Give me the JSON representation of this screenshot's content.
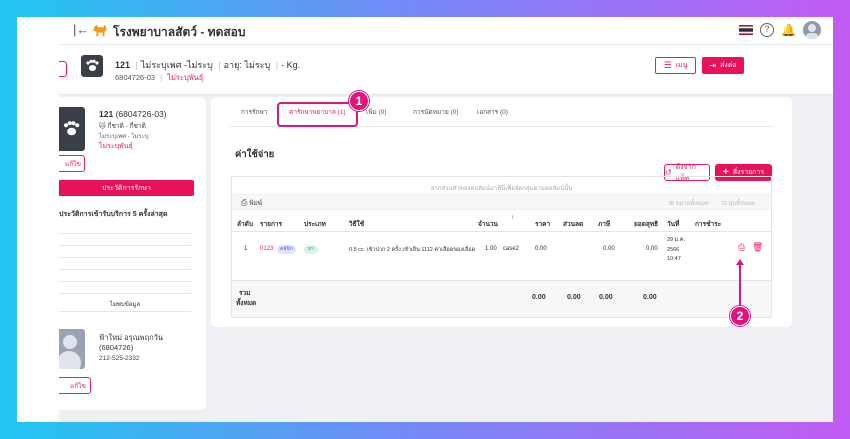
{
  "app": {
    "title": "โรงพยาบาลสัตว์ - ทดสอบ"
  },
  "patient_header": {
    "id": "121",
    "gender": "ไม่ระบุเพศ -ไม่ระบุ",
    "age": "อายุ: ไม่ระบุ",
    "weight": "- Kg.",
    "hn": "6804726-03",
    "sterile": "ไม่ระบุพันธุ์",
    "menu_label": "เมนู",
    "discharge_label": "ส่งต่อ"
  },
  "left_card": {
    "pet_id": "121",
    "pet_hn": "(6804726-03)",
    "species": "🐱 กี่ชาติ - กี่ชาติ",
    "gender_line": "ไม่ระบุเพศ - ไม่ระบุ",
    "breed": "ไม่ระบุพันธุ์",
    "edit_label": "แก้ไข",
    "history_button": "ประวัติการรักษา",
    "recent_title": "ประวัติการเข้ารับบริการ 5 ครั้งล่าสุด",
    "no_data": "ไม่พบข้อมูล",
    "owner_name": "ฟ้าใหม่ อรุณพฤกวัน",
    "owner_id": "(6804726)",
    "owner_phone": "212-525-2332",
    "owner_edit_label": "แก้ไข"
  },
  "tabs": [
    {
      "label": "การรักษา"
    },
    {
      "label": "ค่ารักษาพยาบาล (1)"
    },
    {
      "label": "เพิ่ม (0)"
    },
    {
      "label": "การนัดหมาย (0)"
    },
    {
      "label": "เอกสาร (0)"
    }
  ],
  "annotations": {
    "step1": "1",
    "step2": "2"
  },
  "costs": {
    "title": "ค่าใช้จ่าย",
    "history_button": "ดึงจากแพ็ค",
    "add_button": "สั่งรายการ",
    "hint": "ลากส่วนหัวของคอลัมน์มาที่นี่เพื่อจัดกลุ่มตามคอลัมน์นั้น",
    "print_label": "พิมพ์",
    "tool_right_1": "ขยายทั้งหมด",
    "tool_right_2": "ยุบทั้งหมด",
    "headers": [
      "ลำดับ",
      "รายการ",
      "ประเภท",
      "วิธีใช้",
      "จำนวน",
      "ราคา",
      "ส่วนลด",
      "ภาษี",
      "ยอดสุทธิ",
      "วันที่",
      "การชำระ"
    ],
    "row": {
      "no": "1",
      "code": "0123",
      "item_tag": "คลินิก",
      "type_tag": "ยา",
      "usage": "0.5 cc. เข้าปาก 2 ครั้ง เช้าเย็น 1112 ค่าเลือดของเลือด",
      "qty": "1.00",
      "unit": "case2",
      "price": "0.00",
      "discount": "",
      "tax": "0.00",
      "net": "0.00",
      "date": "29 ม.ค. 2566",
      "time": "10:47"
    },
    "total_label_1": "รวม",
    "total_label_2": "ทั้งหมด",
    "totals": [
      "0.00",
      "0.00",
      "0.00",
      "0.00"
    ]
  },
  "colors": {
    "accent": "#e8115b",
    "annotation": "#e0147a"
  }
}
